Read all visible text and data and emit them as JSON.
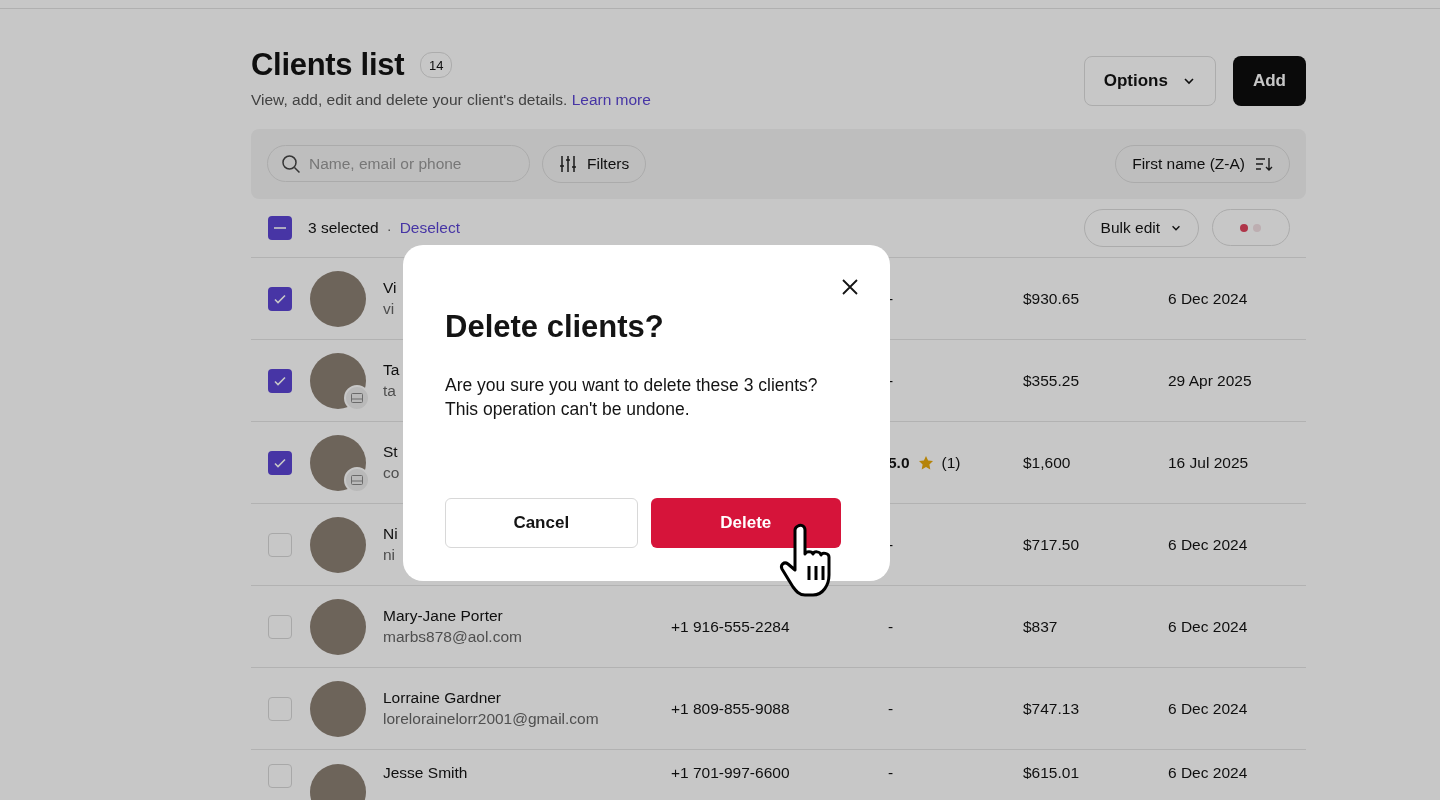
{
  "header": {
    "title": "Clients list",
    "count": "14",
    "subtitle": "View, add, edit and delete your client's details.",
    "link": "Learn more",
    "options_button": "Options",
    "add_button": "Add"
  },
  "toolbar": {
    "search": {
      "placeholder": "Name, email or phone"
    },
    "filters": "Filters",
    "sort": "First name (Z-A)"
  },
  "selection": {
    "indeterminate": true,
    "count_text": "3 selected",
    "separator": "·",
    "deselect": "Deselect",
    "bulk_edit": "Bulk edit"
  },
  "rows": [
    {
      "name": "Vi",
      "email": "vi",
      "phone": "",
      "rating": "-",
      "spend": "$930.65",
      "date": "6 Dec 2024",
      "selected": true,
      "badge": false
    },
    {
      "name": "Ta",
      "email": "ta",
      "phone": "",
      "rating": "-",
      "spend": "$355.25",
      "date": "29 Apr 2025",
      "selected": true,
      "badge": true
    },
    {
      "name": "St",
      "email": "co",
      "phone": "",
      "rating": "5.0",
      "reviews": "(1)",
      "spend": "$1,600",
      "date": "16 Jul 2025",
      "selected": true,
      "badge": true
    },
    {
      "name": "Ni",
      "email": "ni",
      "phone": "",
      "rating": "-",
      "spend": "$717.50",
      "date": "6 Dec 2024",
      "selected": false,
      "badge": false
    },
    {
      "name": "Mary-Jane Porter",
      "email": "marbs878@aol.com",
      "phone": "+1 916-555-2284",
      "rating": "-",
      "spend": "$837",
      "date": "6 Dec 2024",
      "selected": false,
      "badge": false
    },
    {
      "name": "Lorraine Gardner",
      "email": "lorelorainelorr2001@gmail.com",
      "phone": "+1 809-855-9088",
      "rating": "-",
      "spend": "$747.13",
      "date": "6 Dec 2024",
      "selected": false,
      "badge": false
    },
    {
      "name": "Jesse Smith",
      "phone": "+1 701-997-6600",
      "rating": "-",
      "spend": "$615.01",
      "date": "6 Dec 2024",
      "selected": false,
      "badge": false
    }
  ],
  "modal": {
    "title": "Delete clients?",
    "message": "Are you sure you want to delete these 3 clients? This operation can't be undone.",
    "cancel": "Cancel",
    "delete": "Delete"
  }
}
